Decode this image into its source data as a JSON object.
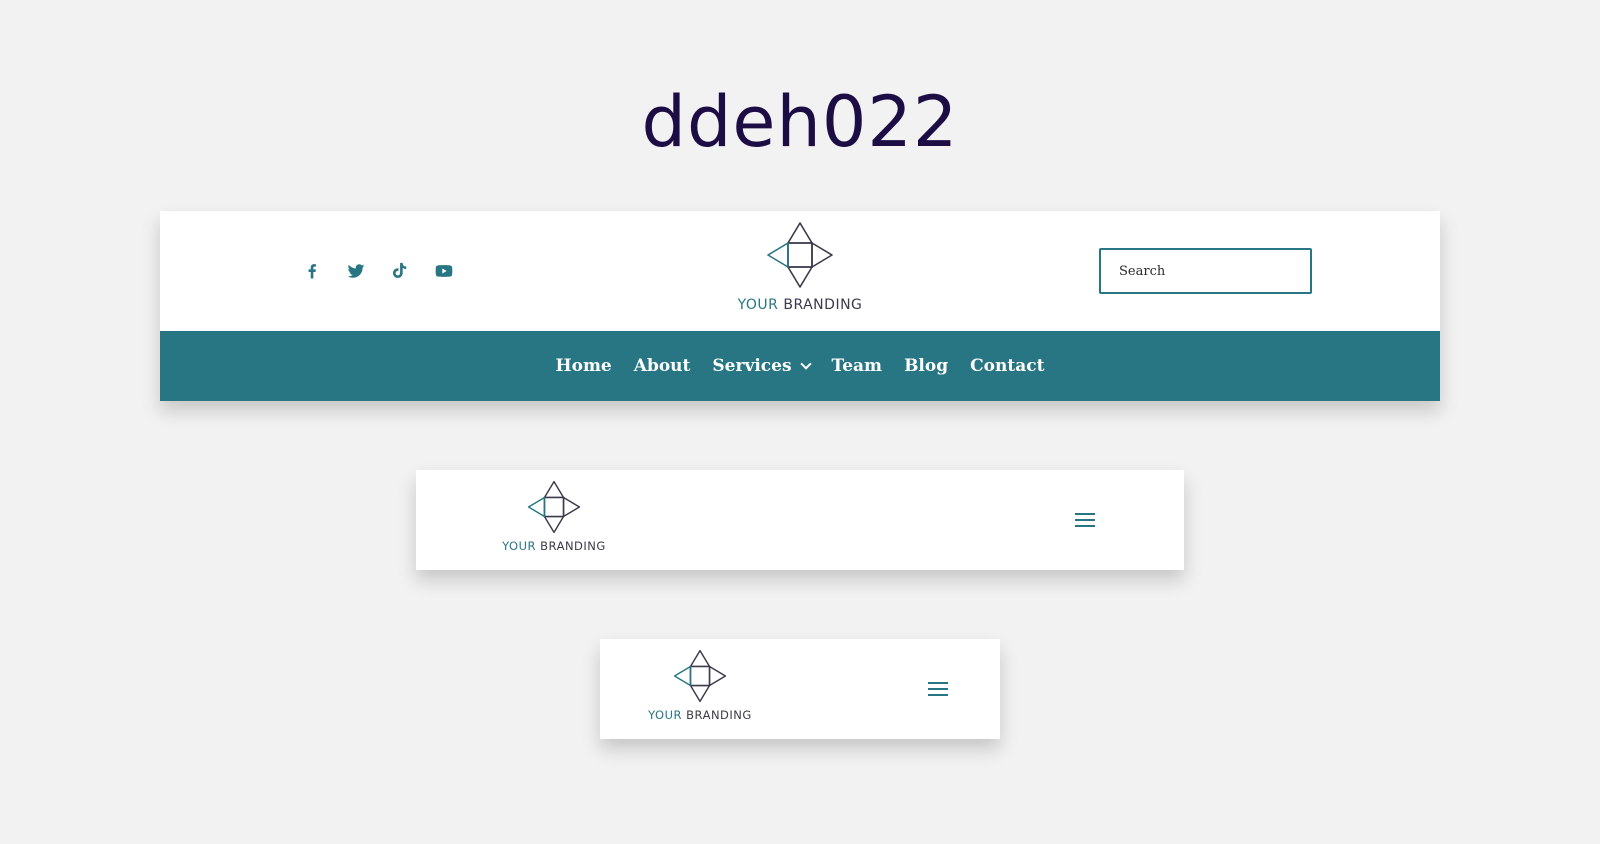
{
  "page": {
    "title": "ddeh022"
  },
  "desktop_header": {
    "social_icons": [
      "facebook-icon",
      "twitter-icon",
      "tiktok-icon",
      "youtube-icon"
    ],
    "logo": {
      "text_accent": "YOUR",
      "text_main": "BRANDING"
    },
    "search": {
      "placeholder": "Search",
      "value": ""
    },
    "nav": {
      "items": [
        {
          "label": "Home"
        },
        {
          "label": "About"
        },
        {
          "label": "Services",
          "has_dropdown": true
        },
        {
          "label": "Team"
        },
        {
          "label": "Blog"
        },
        {
          "label": "Contact"
        }
      ]
    }
  },
  "tablet_header": {
    "logo": {
      "text_accent": "YOUR",
      "text_main": "BRANDING"
    },
    "menu_icon": "hamburger-menu-icon"
  },
  "phone_header": {
    "logo": {
      "text_accent": "YOUR",
      "text_main": "BRANDING"
    },
    "menu_icon": "hamburger-menu-icon"
  },
  "colors": {
    "page_background": "#f2f2f2",
    "title_color": "#1c0d45",
    "brand_teal": "#287683",
    "logo_dark": "#3a3a4a",
    "header_background": "#ffffff",
    "nav_text": "#ffffff"
  }
}
